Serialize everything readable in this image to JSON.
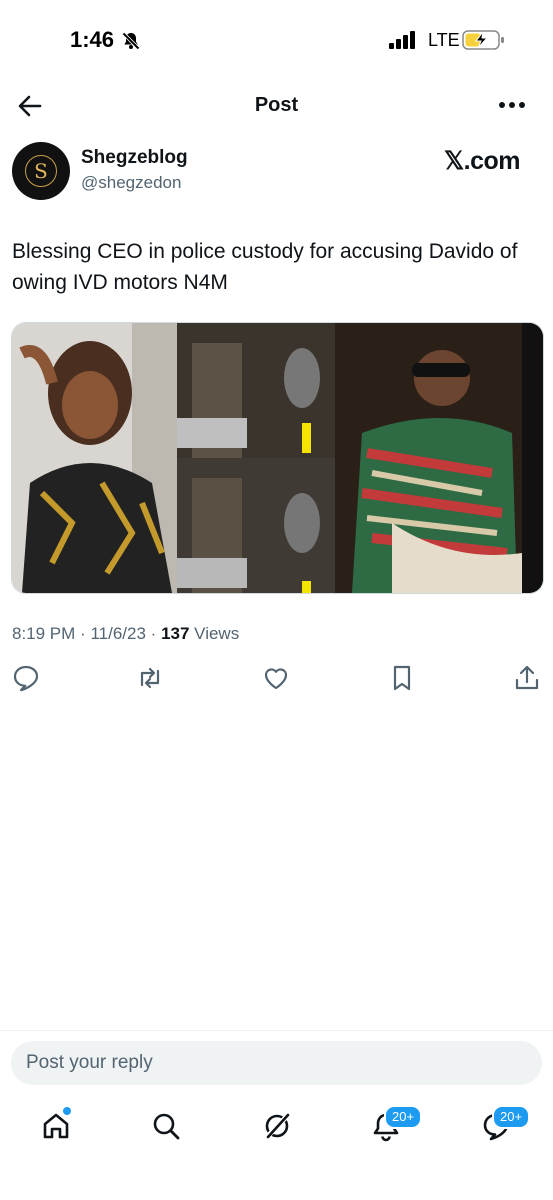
{
  "status": {
    "time": "1:46",
    "network": "LTE"
  },
  "header": {
    "title": "Post"
  },
  "author": {
    "name": "Shegzeblog",
    "handle": "@shegzedon",
    "avatar_letter": "S",
    "source": "𝕏.com"
  },
  "tweet": {
    "text": "Blessing CEO in police custody for accusing Davido of owing IVD motors N4M"
  },
  "meta": {
    "time": "8:19 PM",
    "date": "11/6/23",
    "sep": "·",
    "views_count": "137",
    "views_label": "Views"
  },
  "reply": {
    "placeholder": "Post your reply"
  },
  "nav": {
    "notifications_badge": "20+",
    "messages_badge": "20+"
  },
  "colors": {
    "accent": "#1d9bf0",
    "text": "#0f1419",
    "secondary": "#536471"
  }
}
